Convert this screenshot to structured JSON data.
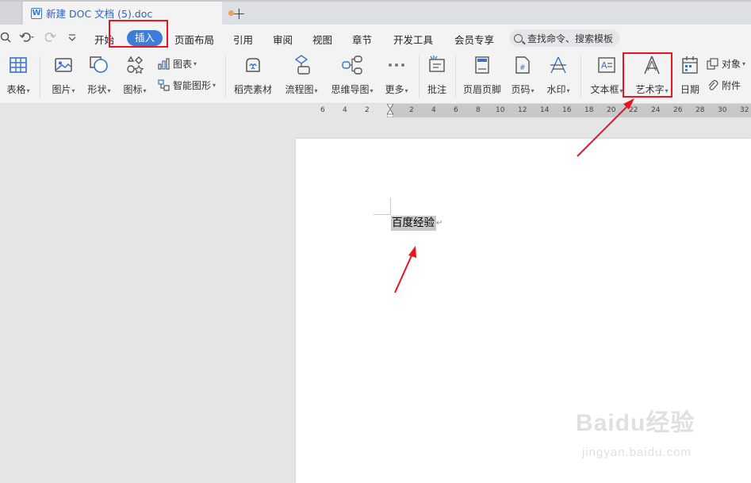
{
  "tabbar": {
    "doc_title": "新建 DOC 文档 (5).doc",
    "doc_icon_letter": "W",
    "new_tab": "+"
  },
  "menubar": {
    "items": [
      "开始",
      "插入",
      "页面布局",
      "引用",
      "审阅",
      "视图",
      "章节",
      "开发工具",
      "会员专享"
    ],
    "active": "插入",
    "search_placeholder": "查找命令、搜索模板"
  },
  "ribbon": {
    "table": "表格",
    "picture": "图片",
    "shape": "形状",
    "icon": "图标",
    "chart": "图表",
    "smart_art": "智能图形",
    "docer_material": "稻壳素材",
    "flowchart": "流程图",
    "mindmap": "思维导图",
    "more": "更多",
    "comment": "批注",
    "header_footer": "页眉页脚",
    "page_number": "页码",
    "watermark": "水印",
    "textbox": "文本框",
    "wordart": "艺术字",
    "date": "日期",
    "object": "对象",
    "attachment": "附件"
  },
  "ruler": {
    "left_numbers": [
      "6",
      "4",
      "2"
    ],
    "right_numbers": [
      "2",
      "4",
      "6",
      "8",
      "10",
      "12",
      "14",
      "16",
      "18",
      "20",
      "22",
      "24",
      "26",
      "28",
      "30",
      "32"
    ]
  },
  "document": {
    "text": "百度经验",
    "paragraph_mark": "↵"
  },
  "watermark": {
    "main": "Baidu经验",
    "sub": "jingyan.baidu.com"
  },
  "colors": {
    "accent": "#3b7dd8",
    "annotation_red": "#e8141e",
    "unsaved_dot": "#f0a04b"
  }
}
